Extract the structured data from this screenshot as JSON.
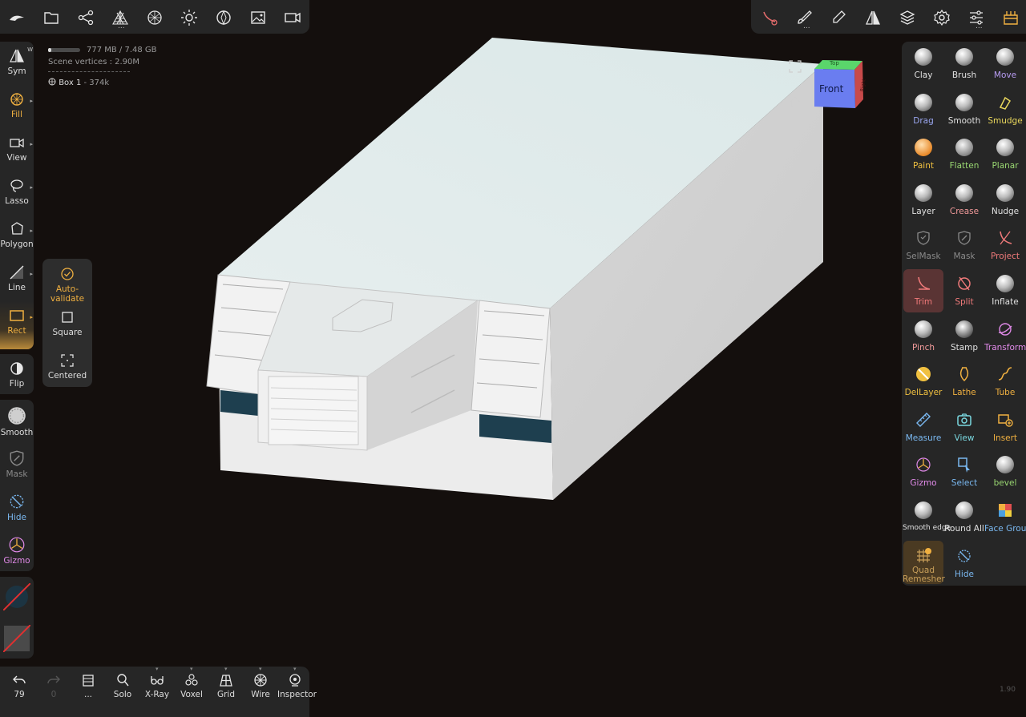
{
  "top_left_toolbar": [
    {
      "icon": "nomad-logo-icon"
    },
    {
      "icon": "folder-icon"
    },
    {
      "icon": "scene-graph-icon"
    },
    {
      "icon": "mesh-icon"
    },
    {
      "icon": "topology-icon"
    },
    {
      "icon": "light-icon"
    },
    {
      "icon": "material-icon"
    },
    {
      "icon": "image-icon"
    },
    {
      "icon": "camera-icon"
    }
  ],
  "top_right_toolbar": [
    {
      "icon": "stroke-icon"
    },
    {
      "icon": "brush-icon"
    },
    {
      "icon": "eyedropper-icon"
    },
    {
      "icon": "symmetry-icon"
    },
    {
      "icon": "layers-icon"
    },
    {
      "icon": "settings-icon"
    },
    {
      "icon": "sliders-icon"
    },
    {
      "icon": "plugin-icon"
    }
  ],
  "stats": {
    "memory": "777 MB / 7.48 GB",
    "memory_fraction": 0.1,
    "vertices": "Scene vertices : 2.90M",
    "object": "Box 1",
    "object_verts": " - 374k"
  },
  "left_tools": [
    {
      "label": "Sym",
      "badge": "W"
    },
    {
      "label": "Fill"
    },
    {
      "label": "View"
    },
    {
      "label": "Lasso"
    },
    {
      "label": "Polygon"
    },
    {
      "label": "Line"
    },
    {
      "label": "Rect"
    },
    {
      "label": "Flip"
    },
    {
      "label": "Smooth"
    },
    {
      "label": "Mask"
    },
    {
      "label": "Hide"
    },
    {
      "label": "Gizmo"
    }
  ],
  "popover": [
    {
      "label": "Auto-validate"
    },
    {
      "label": "Square"
    },
    {
      "label": "Centered"
    }
  ],
  "right_tools": [
    {
      "label": "Clay",
      "color": "#e0e0e0"
    },
    {
      "label": "Brush",
      "color": "#e0e0e0"
    },
    {
      "label": "Move",
      "color": "#b79cf2"
    },
    {
      "label": "Drag",
      "color": "#9aa6f0"
    },
    {
      "label": "Smooth",
      "color": "#e0e0e0"
    },
    {
      "label": "Smudge",
      "color": "#e9d75c"
    },
    {
      "label": "Paint",
      "color": "#f0c040"
    },
    {
      "label": "Flatten",
      "color": "#9ad872"
    },
    {
      "label": "Planar",
      "color": "#9ad872"
    },
    {
      "label": "Layer",
      "color": "#e0e0e0"
    },
    {
      "label": "Crease",
      "color": "#f29a9a"
    },
    {
      "label": "Nudge",
      "color": "#e0e0e0"
    },
    {
      "label": "SelMask",
      "color": "#8a8a8a"
    },
    {
      "label": "Mask",
      "color": "#8a8a8a"
    },
    {
      "label": "Project",
      "color": "#f07a7a"
    },
    {
      "label": "Trim",
      "color": "#f07a7a"
    },
    {
      "label": "Split",
      "color": "#f07a7a"
    },
    {
      "label": "Inflate",
      "color": "#e0e0e0"
    },
    {
      "label": "Pinch",
      "color": "#f29a9a"
    },
    {
      "label": "Stamp",
      "color": "#e0e0e0"
    },
    {
      "label": "Transform",
      "color": "#e08ae8"
    },
    {
      "label": "DelLayer",
      "color": "#f0c040"
    },
    {
      "label": "Lathe",
      "color": "#f0b040"
    },
    {
      "label": "Tube",
      "color": "#f0b040"
    },
    {
      "label": "Measure",
      "color": "#7ab8f0"
    },
    {
      "label": "View",
      "color": "#7ad8e0"
    },
    {
      "label": "Insert",
      "color": "#f0b040"
    },
    {
      "label": "Gizmo",
      "color": "#e08ae8"
    },
    {
      "label": "Select",
      "color": "#7ab8f0"
    },
    {
      "label": "bevel",
      "color": "#9ad872"
    },
    {
      "label": "Smooth edge",
      "color": "#e0e0e0"
    },
    {
      "label": "Round All",
      "color": "#e0e0e0"
    },
    {
      "label": "Face Group",
      "color": "#7ab8f0"
    },
    {
      "label": "Quad Remesher",
      "color": "#c9a05a"
    },
    {
      "label": "Hide",
      "color": "#7ab8f0"
    }
  ],
  "bottom_bar": [
    {
      "label": "79",
      "icon": "undo-icon"
    },
    {
      "label": "0",
      "icon": "redo-icon"
    },
    {
      "label": "...",
      "icon": "history-icon"
    },
    {
      "label": "Solo",
      "icon": "solo-icon"
    },
    {
      "label": "X-Ray",
      "icon": "xray-icon"
    },
    {
      "label": "Voxel",
      "icon": "voxel-icon"
    },
    {
      "label": "Grid",
      "icon": "grid-icon"
    },
    {
      "label": "Wire",
      "icon": "wire-icon"
    },
    {
      "label": "Inspector",
      "icon": "inspector-icon"
    }
  ],
  "view_cube": {
    "front": "Front",
    "top": "Top",
    "right": "Right"
  },
  "version": "1.90"
}
